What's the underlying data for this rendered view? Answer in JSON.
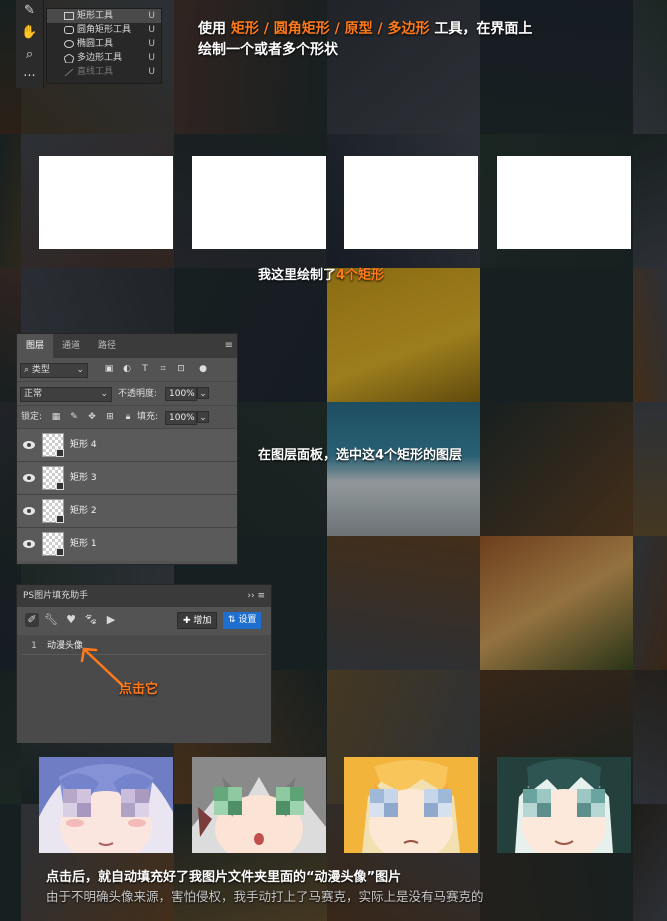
{
  "tool_flyout": {
    "items": [
      {
        "label": "矩形工具",
        "shortcut": "U",
        "icon": "rectangle-icon",
        "selected": true
      },
      {
        "label": "圆角矩形工具",
        "shortcut": "U",
        "icon": "rounded-rectangle-icon"
      },
      {
        "label": "椭圆工具",
        "shortcut": "U",
        "icon": "ellipse-icon"
      },
      {
        "label": "多边形工具",
        "shortcut": "U",
        "icon": "polygon-icon"
      },
      {
        "label": "直线工具",
        "shortcut": "U",
        "icon": "line-icon",
        "dim": true
      }
    ]
  },
  "step1": {
    "part1": "使用 ",
    "hl1": "矩形 / 圆角矩形 / 原型 / 多边形",
    "part2": " 工具，在界面上",
    "line2": "绘制一个或者多个形状"
  },
  "step2": {
    "part1": "我这里绘制了",
    "hl": "4个矩形"
  },
  "layers_panel": {
    "tabs": [
      "图层",
      "通道",
      "路径"
    ],
    "filter_label": "类型",
    "blend_mode": "正常",
    "opacity_label": "不透明度:",
    "opacity_value": "100%",
    "lock_label": "锁定:",
    "fill_label": "填充:",
    "fill_value": "100%",
    "layers": [
      {
        "name": "矩形 4"
      },
      {
        "name": "矩形 3"
      },
      {
        "name": "矩形 2"
      },
      {
        "name": "矩形 1"
      }
    ]
  },
  "step3": {
    "text": "在图层面板，选中这4个矩形的图层"
  },
  "plugin_panel": {
    "title": "PS图片填充助手",
    "collapse_label": "››",
    "add_label": "增加",
    "settings_label": "设置",
    "items": [
      {
        "index": "1",
        "label": "动漫头像"
      }
    ]
  },
  "step4": {
    "text": "点击它"
  },
  "footer": {
    "line1": "点击后，就自动填充好了我图片文件夹里面的“动漫头像”图片",
    "line2": "由于不明确头像来源，害怕侵权，我手动打上了马赛克，实际上是没有马赛克的"
  },
  "colors": {
    "accent": "#ff7a1a",
    "primary_button": "#1f6fd0"
  }
}
